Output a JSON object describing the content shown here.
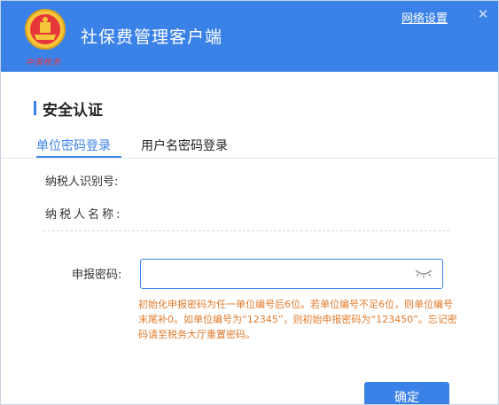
{
  "header": {
    "app_title": "社保费管理客户端",
    "logo_caption": "中国税务",
    "network_settings": "网络设置",
    "close_glyph": "✕"
  },
  "section": {
    "title": "安全认证"
  },
  "tabs": [
    {
      "label": "单位密码登录",
      "active": true
    },
    {
      "label": "用户名密码登录",
      "active": false
    }
  ],
  "info": {
    "taxpayer_id_label": "纳税人识别号:",
    "taxpayer_name_label": "纳税人名称:"
  },
  "password": {
    "label": "申报密码:",
    "value": "",
    "placeholder": ""
  },
  "hint": {
    "text": "初始化申报密码为任一单位编号后6位。若单位编号不足6位，则单位编号末尾补0。如单位编号为“12345”，则初始申报密码为“123450”。忘记密码请至税务大厅重置密码。"
  },
  "actions": {
    "confirm_label": "确定"
  },
  "colors": {
    "primary": "#3b82e8",
    "hint": "#e07a2a",
    "logo_red": "#e6373a"
  },
  "icons": {
    "logo": "tax-emblem-icon",
    "close": "close-icon",
    "eye": "eye-closed-icon"
  }
}
